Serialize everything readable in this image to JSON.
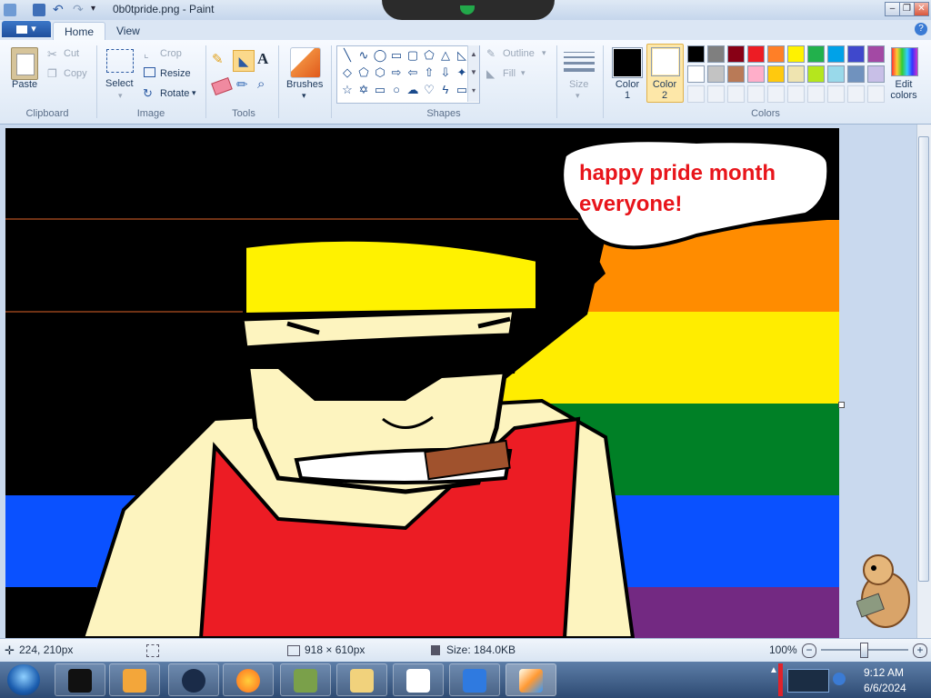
{
  "window": {
    "title": "0b0tpride.png - Paint"
  },
  "tabs": {
    "app_menu": "▾",
    "home": "Home",
    "view": "View",
    "help": "?"
  },
  "ribbon": {
    "clipboard": {
      "label": "Clipboard",
      "paste": "Paste",
      "cut": "Cut",
      "copy": "Copy"
    },
    "image": {
      "label": "Image",
      "select": "Select",
      "crop": "Crop",
      "resize": "Resize",
      "rotate": "Rotate"
    },
    "tools": {
      "label": "Tools"
    },
    "brushes": {
      "label": "Brushes"
    },
    "shapes": {
      "label": "Shapes",
      "outline": "Outline",
      "fill": "Fill"
    },
    "size": {
      "label": "Size"
    },
    "colors": {
      "label": "Colors",
      "color1": "Color 1",
      "color2": "Color 2",
      "edit": "Edit colors",
      "color1_value": "#000000",
      "color2_value": "#ffffff",
      "palette_row1": [
        "#000000",
        "#7f7f7f",
        "#880015",
        "#ed1c24",
        "#ff7f27",
        "#fff200",
        "#22b14c",
        "#00a2e8",
        "#3f48cc",
        "#a349a4"
      ],
      "palette_row2": [
        "#ffffff",
        "#c3c3c3",
        "#b97a57",
        "#ffaec9",
        "#ffc90e",
        "#efe4b0",
        "#b5e61d",
        "#99d9ea",
        "#7092be",
        "#c8bfe7"
      ]
    }
  },
  "canvas": {
    "speech_line1": "happy pride month",
    "speech_line2": "everyone!",
    "flag_colors": [
      "#000000",
      "#ff8c00",
      "#ffed00",
      "#008026",
      "#0a51ff",
      "#732982"
    ],
    "text_color": "#e8151b"
  },
  "status": {
    "cursor": "224, 210px",
    "dimensions": "918 × 610px",
    "size": "Size: 184.0KB",
    "zoom": "100%"
  },
  "taskbar": {
    "time": "9:12 AM",
    "date": "6/6/2024"
  }
}
